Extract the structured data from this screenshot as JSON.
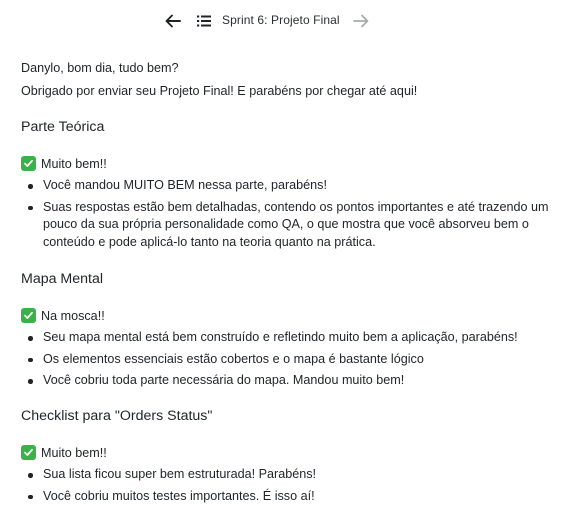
{
  "nav": {
    "title": "Sprint 6: Projeto Final",
    "back_icon": "arrow-left-icon",
    "list_icon": "list-icon",
    "forward_icon": "arrow-right-icon"
  },
  "colors": {
    "check_bg": "#38b249",
    "text": "#1f2328",
    "forward_disabled": "#a6a9ad"
  },
  "intro": {
    "greeting": "Danylo, bom dia, tudo bem?",
    "thanks": "Obrigado por enviar seu Projeto Final! E parabéns por chegar até aqui!"
  },
  "sections": [
    {
      "heading": "Parte Teórica",
      "verdict": "Muito bem!!",
      "bullets": [
        "Você mandou MUITO BEM nessa parte, parabéns!",
        "Suas respostas estão bem detalhadas, contendo os pontos importantes e até trazendo um pouco da sua própria personalidade como QA, o que mostra que você absorveu bem o conteúdo e pode aplicá-lo tanto na teoria quanto na prática."
      ]
    },
    {
      "heading": "Mapa Mental",
      "verdict": "Na mosca!!",
      "bullets": [
        "Seu mapa mental está bem construído e refletindo muito bem a aplicação, parabéns!",
        "Os elementos essenciais estão cobertos e o mapa é bastante lógico",
        "Você cobriu toda parte necessária do mapa. Mandou muito bem!"
      ]
    },
    {
      "heading": "Checklist para \"Orders Status\"",
      "verdict": "Muito bem!!",
      "bullets": [
        "Sua lista ficou super bem estruturada! Parabéns!",
        "Você cobriu muitos testes importantes. É isso aí!"
      ]
    }
  ]
}
